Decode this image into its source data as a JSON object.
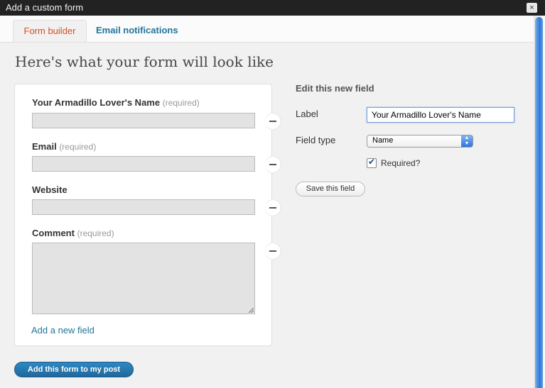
{
  "window": {
    "title": "Add a custom form",
    "close_label": "×"
  },
  "tabs": [
    {
      "label": "Form builder"
    },
    {
      "label": "Email notifications"
    }
  ],
  "page_title": "Here's what your form will look like",
  "preview": {
    "fields": [
      {
        "label": "Your Armadillo Lover's Name",
        "required_text": "(required)"
      },
      {
        "label": "Email",
        "required_text": "(required)"
      },
      {
        "label": "Website",
        "required_text": ""
      },
      {
        "label": "Comment",
        "required_text": "(required)"
      }
    ],
    "add_field_label": "Add a new field"
  },
  "editor": {
    "heading": "Edit this new field",
    "label_caption": "Label",
    "label_value": "Your Armadillo Lover's Name",
    "type_caption": "Field type",
    "type_value": "Name",
    "required_label": "Required?",
    "required_checked": true,
    "save_label": "Save this field"
  },
  "primary_button": "Add this form to my post",
  "colors": {
    "accent_link": "#21759b",
    "active_tab": "#d54e21",
    "primary_button": "#21759b"
  }
}
